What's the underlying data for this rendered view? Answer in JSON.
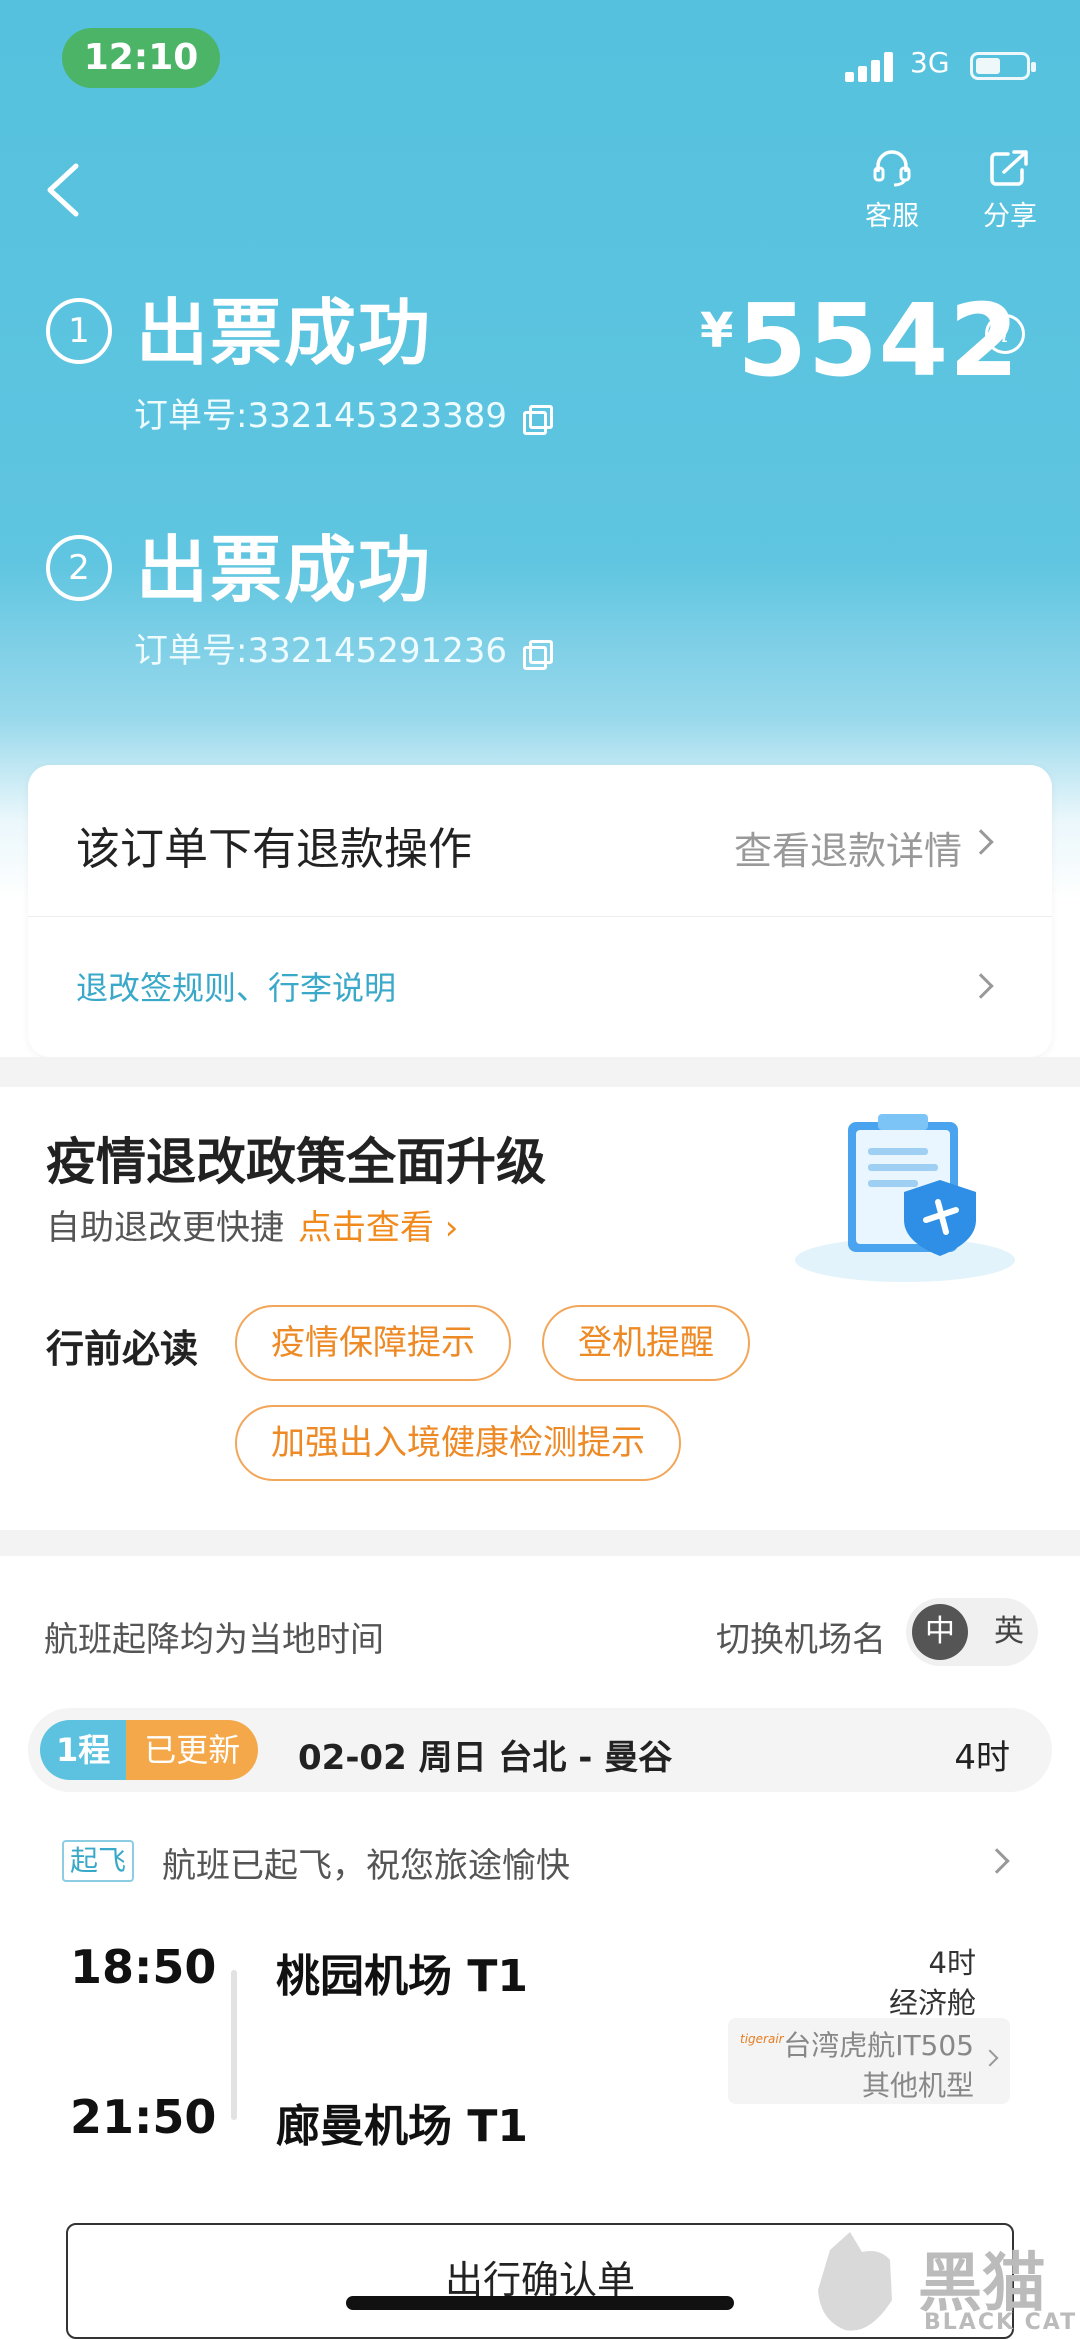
{
  "status_bar": {
    "time": "12:10",
    "network": "3G"
  },
  "header": {
    "service_label": "客服",
    "share_label": "分享"
  },
  "orders": [
    {
      "index": "1",
      "status": "出票成功",
      "order_no": "订单号:332145323389"
    },
    {
      "index": "2",
      "status": "出票成功",
      "order_no": "订单号:332145291236"
    }
  ],
  "price": {
    "currency": "¥",
    "amount": "5542"
  },
  "refund_card": {
    "title": "该订单下有退款操作",
    "detail_link": "查看退款详情",
    "rules_link": "退改签规则、行李说明"
  },
  "policy": {
    "title": "疫情退改政策全面升级",
    "subtitle": "自助退改更快捷",
    "action": "点击查看 ›"
  },
  "must_read": {
    "label": "行前必读",
    "pills": [
      "疫情保障提示",
      "登机提醒",
      "加强出入境健康检测提示"
    ]
  },
  "flight_section": {
    "note": "航班起降均为当地时间",
    "switch_label": "切换机场名",
    "lang_on": "中",
    "lang_off": "英"
  },
  "trip": {
    "segment": "1程",
    "updated": "已更新",
    "info": "02-02 周日 台北 - 曼谷",
    "duration": "4时"
  },
  "status": {
    "tag": "起飞",
    "text": "航班已起飞，祝您旅途愉快"
  },
  "flight": {
    "dep_time": "18:50",
    "dep_airport": "桃园机场 T1",
    "arr_time": "21:50",
    "arr_airport": "廊曼机场 T1",
    "duration": "4时",
    "cabin": "经济舱",
    "carrier_logo": "tigerair",
    "carrier": "台湾虎航IT505",
    "aircraft": "其他机型"
  },
  "confirm_button": "出行确认单",
  "watermark": {
    "cn": "黑猫",
    "en": "BLACK CAT"
  },
  "colors": {
    "primary": "#55c1de",
    "accent_orange": "#ee8a25",
    "status_green": "#4cb466"
  }
}
